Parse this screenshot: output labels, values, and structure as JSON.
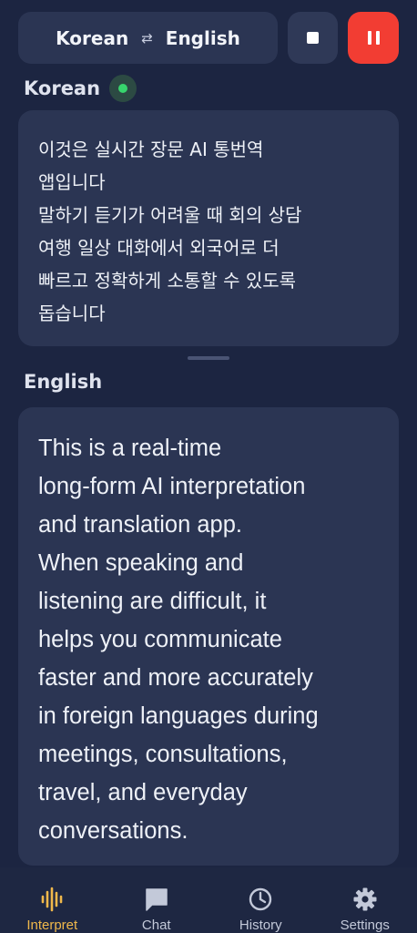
{
  "header": {
    "source_language": "Korean",
    "target_language": "English",
    "swap_icon": "swap-arrows-icon"
  },
  "controls": {
    "stop_icon": "stop-icon",
    "pause_icon": "pause-icon",
    "pause_color": "#f23d33"
  },
  "source_panel": {
    "label": "Korean",
    "live_indicator_color": "#37d56d",
    "text": "이것은 실시간 장문 AI 통번역\n앱입니다\n말하기 듣기가 어려울 때 회의 상담\n여행 일상 대화에서 외국어로 더\n빠르고 정확하게 소통할 수 있도록\n돕습니다"
  },
  "target_panel": {
    "label": "English",
    "text": "This is a real-time\nlong-form AI interpretation\nand translation app.\nWhen speaking and\nlistening are difficult, it\nhelps you communicate\nfaster and more accurately\nin foreign languages during\nmeetings, consultations,\ntravel, and everyday\nconversations."
  },
  "nav": {
    "accent_color": "#f0b84b",
    "items": [
      {
        "label": "Interpret",
        "icon": "waveform-icon",
        "active": true
      },
      {
        "label": "Chat",
        "icon": "chat-bubble-icon",
        "active": false
      },
      {
        "label": "History",
        "icon": "clock-icon",
        "active": false
      },
      {
        "label": "Settings",
        "icon": "gear-icon",
        "active": false
      }
    ]
  }
}
